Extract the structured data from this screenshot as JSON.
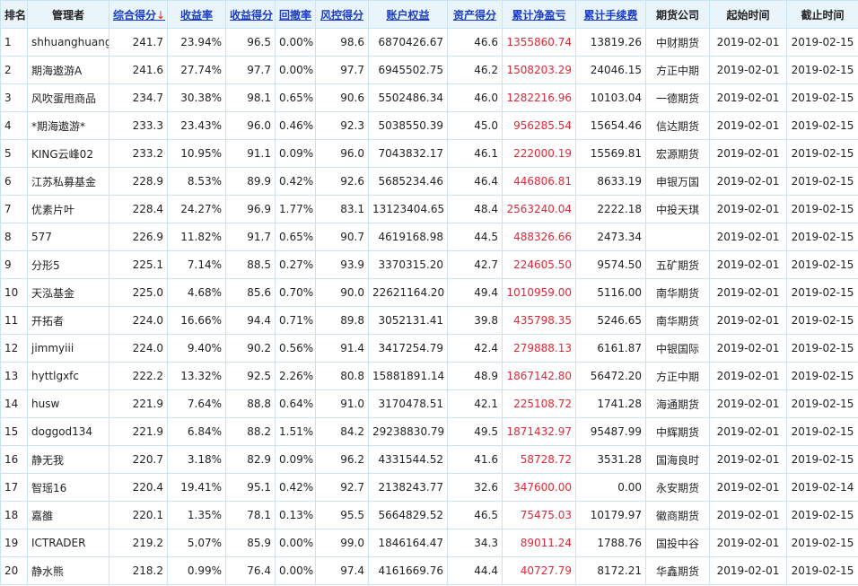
{
  "headers": [
    {
      "label": "排名",
      "sortable": false
    },
    {
      "label": "管理者",
      "sortable": false
    },
    {
      "label": "综合得分",
      "sortable": true,
      "active": true,
      "arrow": "↓"
    },
    {
      "label": "收益率",
      "sortable": true
    },
    {
      "label": "收益得分",
      "sortable": true
    },
    {
      "label": "回撤率",
      "sortable": true
    },
    {
      "label": "风控得分",
      "sortable": true
    },
    {
      "label": "账户权益",
      "sortable": true
    },
    {
      "label": "资产得分",
      "sortable": true
    },
    {
      "label": "累计净盈亏",
      "sortable": true
    },
    {
      "label": "累计手续费",
      "sortable": true
    },
    {
      "label": "期货公司",
      "sortable": false
    },
    {
      "label": "起始时间",
      "sortable": false
    },
    {
      "label": "截止时间",
      "sortable": false
    }
  ],
  "colors": {
    "header_bg": "#eaf4fb",
    "border": "#c9e3f3",
    "link": "#1a3cc8",
    "profit": "#e32636"
  },
  "rows": [
    [
      "1",
      "shhuanghuang",
      "241.7",
      "23.94%",
      "96.5",
      "0.00%",
      "98.6",
      "6870426.67",
      "46.6",
      "1355860.74",
      "13819.26",
      "中财期货",
      "2019-02-01",
      "2019-02-15"
    ],
    [
      "2",
      "期海遨游A",
      "241.6",
      "27.74%",
      "97.7",
      "0.00%",
      "97.7",
      "6945502.75",
      "46.2",
      "1508203.29",
      "24046.15",
      "方正中期",
      "2019-02-01",
      "2019-02-15"
    ],
    [
      "3",
      "风吹蛋甩商品",
      "234.7",
      "30.38%",
      "98.1",
      "0.65%",
      "90.6",
      "5502486.34",
      "46.0",
      "1282216.96",
      "10103.04",
      "一德期货",
      "2019-02-01",
      "2019-02-15"
    ],
    [
      "4",
      "*期海遨游*",
      "233.3",
      "23.43%",
      "96.0",
      "0.46%",
      "92.3",
      "5038550.39",
      "45.0",
      "956285.54",
      "15654.46",
      "信达期货",
      "2019-02-01",
      "2019-02-15"
    ],
    [
      "5",
      "KING云峰02",
      "233.2",
      "10.95%",
      "91.1",
      "0.09%",
      "96.0",
      "7043832.17",
      "46.1",
      "222000.19",
      "15569.81",
      "宏源期货",
      "2019-02-01",
      "2019-02-15"
    ],
    [
      "6",
      "江苏私募基金",
      "228.9",
      "8.53%",
      "89.9",
      "0.42%",
      "92.6",
      "5685234.46",
      "46.4",
      "446806.81",
      "8633.19",
      "申银万国",
      "2019-02-01",
      "2019-02-15"
    ],
    [
      "7",
      "优素片叶",
      "228.4",
      "24.27%",
      "96.9",
      "1.77%",
      "83.1",
      "13123404.65",
      "48.4",
      "2563240.04",
      "2222.18",
      "中投天琪",
      "2019-02-01",
      "2019-02-15"
    ],
    [
      "8",
      "577",
      "226.9",
      "11.82%",
      "91.7",
      "0.65%",
      "90.7",
      "4619168.98",
      "44.5",
      "488326.66",
      "2473.34",
      "",
      "2019-02-01",
      "2019-02-15"
    ],
    [
      "9",
      "分形5",
      "225.1",
      "7.14%",
      "88.5",
      "0.27%",
      "93.9",
      "3370315.20",
      "42.7",
      "224605.50",
      "9574.50",
      "五矿期货",
      "2019-02-01",
      "2019-02-15"
    ],
    [
      "10",
      "天泓基金",
      "225.0",
      "4.68%",
      "85.6",
      "0.70%",
      "90.0",
      "22621164.20",
      "49.4",
      "1010959.00",
      "5116.00",
      "南华期货",
      "2019-02-01",
      "2019-02-15"
    ],
    [
      "11",
      "开拓者",
      "224.0",
      "16.66%",
      "94.4",
      "0.71%",
      "89.8",
      "3052131.41",
      "39.8",
      "435798.35",
      "5246.65",
      "南华期货",
      "2019-02-01",
      "2019-02-15"
    ],
    [
      "12",
      "jimmyiii",
      "224.0",
      "9.40%",
      "90.2",
      "0.56%",
      "91.4",
      "3417254.79",
      "42.4",
      "279888.13",
      "6161.87",
      "中银国际",
      "2019-02-01",
      "2019-02-15"
    ],
    [
      "13",
      "hyttlgxfc",
      "222.2",
      "13.32%",
      "92.5",
      "2.26%",
      "80.8",
      "15881891.14",
      "48.9",
      "1867142.80",
      "56472.20",
      "方正中期",
      "2019-02-01",
      "2019-02-15"
    ],
    [
      "14",
      "husw",
      "221.9",
      "7.64%",
      "88.8",
      "0.64%",
      "91.0",
      "3170478.51",
      "42.1",
      "225108.72",
      "1741.28",
      "海通期货",
      "2019-02-01",
      "2019-02-15"
    ],
    [
      "15",
      "doggod134",
      "221.9",
      "6.84%",
      "88.2",
      "1.51%",
      "84.2",
      "29238830.79",
      "49.5",
      "1871432.97",
      "95487.99",
      "中辉期货",
      "2019-02-01",
      "2019-02-15"
    ],
    [
      "16",
      "静无我",
      "220.7",
      "3.18%",
      "82.9",
      "0.09%",
      "96.2",
      "4331544.52",
      "41.6",
      "58728.72",
      "3531.28",
      "国海良时",
      "2019-02-01",
      "2019-02-15"
    ],
    [
      "17",
      "智瑶16",
      "220.4",
      "19.41%",
      "95.1",
      "0.42%",
      "92.7",
      "2138243.77",
      "32.6",
      "347600.00",
      "0.00",
      "永安期货",
      "2019-02-01",
      "2019-02-14"
    ],
    [
      "18",
      "嘉雒",
      "220.1",
      "1.35%",
      "78.1",
      "0.13%",
      "95.5",
      "5664829.52",
      "46.5",
      "75475.03",
      "10179.97",
      "徽商期货",
      "2019-02-01",
      "2019-02-15"
    ],
    [
      "19",
      "ICTRADER",
      "219.2",
      "5.07%",
      "85.9",
      "0.00%",
      "99.0",
      "1846164.47",
      "34.3",
      "89011.24",
      "1788.76",
      "国投中谷",
      "2019-02-01",
      "2019-02-15"
    ],
    [
      "20",
      "静水熊",
      "218.2",
      "0.99%",
      "76.4",
      "0.00%",
      "97.4",
      "4161669.76",
      "44.4",
      "40727.79",
      "8172.21",
      "华鑫期货",
      "2019-02-01",
      "2019-02-15"
    ]
  ]
}
